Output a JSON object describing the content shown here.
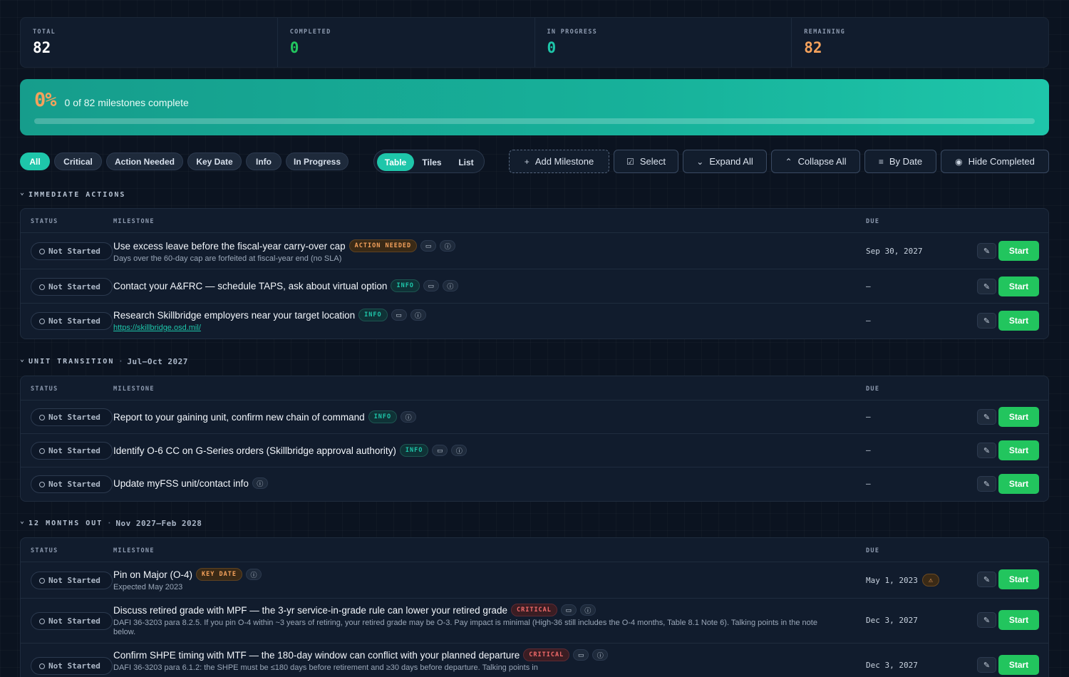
{
  "stats": {
    "total": {
      "label": "TOTAL",
      "value": "82",
      "color": "#ffffff"
    },
    "completed": {
      "label": "COMPLETED",
      "value": "0",
      "color": "#22c55e"
    },
    "in_progress": {
      "label": "IN PROGRESS",
      "value": "0",
      "color": "#1ec6aa"
    },
    "remaining": {
      "label": "REMAINING",
      "value": "82",
      "color": "#f5a25c"
    }
  },
  "progress": {
    "percent_label": "0%",
    "text": "0 of 82 milestones complete",
    "fraction": 0
  },
  "filters": [
    "All",
    "Critical",
    "Action Needed",
    "Key Date",
    "Info",
    "In Progress"
  ],
  "active_filter": "All",
  "views": [
    "Table",
    "Tiles",
    "List"
  ],
  "active_view": "Table",
  "actions": {
    "add": "Add Milestone",
    "select": "Select",
    "expand": "Expand All",
    "collapse": "Collapse All",
    "sort": "By Date",
    "hide": "Hide Completed"
  },
  "columns": {
    "status": "STATUS",
    "milestone": "MILESTONE",
    "due": "DUE"
  },
  "row_labels": {
    "status": "Not Started",
    "start": "Start"
  },
  "icons": {
    "book": "book-icon",
    "info": "info-icon",
    "edit": "pencil-icon",
    "warning": "warning-icon"
  },
  "sections": [
    {
      "title": "IMMEDIATE ACTIONS",
      "range": "",
      "rows": [
        {
          "title": "Use excess leave before the fiscal-year carry-over cap",
          "tag": "ACTION NEEDED",
          "tag_type": "action",
          "book": true,
          "info": true,
          "desc": "Days over the 60-day cap are forfeited at fiscal-year end (no SLA)",
          "link": "",
          "due": "Sep 30, 2027",
          "warn": false
        },
        {
          "title": "Contact your A&FRC — schedule TAPS, ask about virtual option",
          "tag": "INFO",
          "tag_type": "info",
          "book": true,
          "info": true,
          "desc": "",
          "link": "",
          "due": "–",
          "warn": false
        },
        {
          "title": "Research Skillbridge employers near your target location",
          "tag": "INFO",
          "tag_type": "info",
          "book": true,
          "info": true,
          "desc": "",
          "link": "https://skillbridge.osd.mil/",
          "due": "–",
          "warn": false
        }
      ]
    },
    {
      "title": "UNIT TRANSITION",
      "range": "Jul–Oct 2027",
      "rows": [
        {
          "title": "Report to your gaining unit, confirm new chain of command",
          "tag": "INFO",
          "tag_type": "info",
          "book": false,
          "info": true,
          "desc": "",
          "link": "",
          "due": "–",
          "warn": false
        },
        {
          "title": "Identify O-6 CC on G-Series orders (Skillbridge approval authority)",
          "tag": "INFO",
          "tag_type": "info",
          "book": true,
          "info": true,
          "desc": "",
          "link": "",
          "due": "–",
          "warn": false
        },
        {
          "title": "Update myFSS unit/contact info",
          "tag": "",
          "tag_type": "",
          "book": false,
          "info": true,
          "desc": "",
          "link": "",
          "due": "–",
          "warn": false
        }
      ]
    },
    {
      "title": "12 MONTHS OUT",
      "range": "Nov 2027–Feb 2028",
      "rows": [
        {
          "title": "Pin on Major (O-4)",
          "tag": "KEY DATE",
          "tag_type": "key",
          "book": false,
          "info": true,
          "desc": "Expected May 2023",
          "link": "",
          "due": "May 1, 2023",
          "warn": true
        },
        {
          "title": "Discuss retired grade with MPF — the 3-yr service-in-grade rule can lower your retired grade",
          "tag": "CRITICAL",
          "tag_type": "critical",
          "book": true,
          "info": true,
          "desc": "DAFI 36-3203 para 8.2.5. If you pin O-4 within ~3 years of retiring, your retired grade may be O-3. Pay impact is minimal (High-36 still includes the O-4 months, Table 8.1 Note 6). Talking points in the note below.",
          "link": "",
          "due": "Dec 3, 2027",
          "warn": false
        },
        {
          "title": "Confirm SHPE timing with MTF — the 180-day window can conflict with your planned departure",
          "tag": "CRITICAL",
          "tag_type": "critical",
          "book": true,
          "info": true,
          "desc": "DAFI 36-3203 para 6.1.2: the SHPE must be ≤180 days before retirement and ≥30 days before departure. Talking points in",
          "link": "",
          "due": "Dec 3, 2027",
          "warn": false
        }
      ]
    }
  ]
}
